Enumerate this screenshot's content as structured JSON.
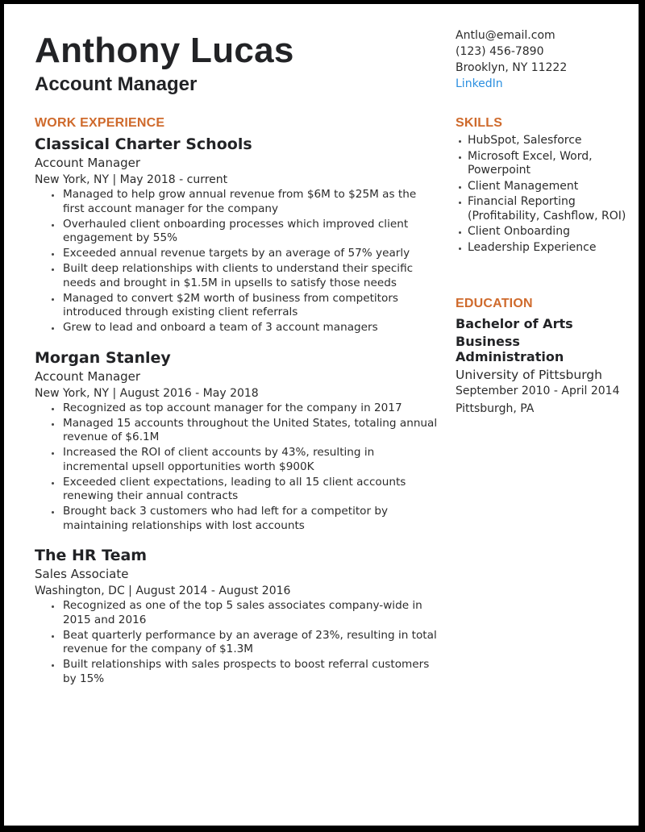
{
  "header": {
    "name": "Anthony Lucas",
    "headline": "Account Manager"
  },
  "contact": {
    "email": "Antlu@email.com",
    "phone": "(123) 456-7890",
    "location": "Brooklyn, NY 11222",
    "linkedin_label": "LinkedIn"
  },
  "work": {
    "title": "WORK EXPERIENCE",
    "jobs": [
      {
        "company": "Classical Charter Schools",
        "role": "Account Manager",
        "meta": "New York, NY  |  May 2018 - current",
        "bullets": [
          "Managed to help grow annual revenue from $6M to $25M as the first account manager for the company",
          "Overhauled client onboarding processes which improved client engagement by 55%",
          "Exceeded annual revenue targets by an average of 57% yearly",
          "Built deep relationships with clients to understand their specific needs and brought in $1.5M in upsells to satisfy those needs",
          "Managed to convert $2M worth of business from competitors introduced through existing client referrals",
          "Grew to lead and onboard a team of 3 account managers"
        ]
      },
      {
        "company": "Morgan Stanley",
        "role": "Account Manager",
        "meta": "New York, NY  |  August 2016 - May 2018",
        "bullets": [
          "Recognized as top account manager for the company in 2017",
          "Managed 15 accounts throughout the United States, totaling annual revenue of $6.1M",
          "Increased the ROI of client accounts by 43%, resulting in incremental upsell opportunities worth $900K",
          "Exceeded client expectations, leading to all 15 client accounts renewing their annual contracts",
          "Brought back 3 customers who had left for a competitor by maintaining relationships with lost accounts"
        ]
      },
      {
        "company": "The HR Team",
        "role": "Sales Associate",
        "meta": "Washington, DC  |  August 2014 - August 2016",
        "bullets": [
          "Recognized as one of the top 5 sales associates company-wide in 2015 and 2016",
          "Beat quarterly performance by an average of 23%, resulting in total revenue for the company of $1.3M",
          "Built relationships with sales prospects to boost referral customers by 15%"
        ]
      }
    ]
  },
  "skills": {
    "title": "SKILLS",
    "items": [
      "HubSpot, Salesforce",
      "Microsoft Excel, Word, Powerpoint",
      "Client Management",
      "Financial Reporting (Profitability, Cashflow, ROI)",
      "Client Onboarding",
      "Leadership Experience"
    ]
  },
  "education": {
    "title": "EDUCATION",
    "degree": "Bachelor of Arts",
    "major": "Business Administration",
    "school": "University of Pittsburgh",
    "dates": "September 2010 - April 2014",
    "location": "Pittsburgh, PA"
  },
  "colors": {
    "accent": "#cf6a2c",
    "link": "#2b8fe0",
    "text": "#2b2b2b",
    "frame": "#000000"
  }
}
